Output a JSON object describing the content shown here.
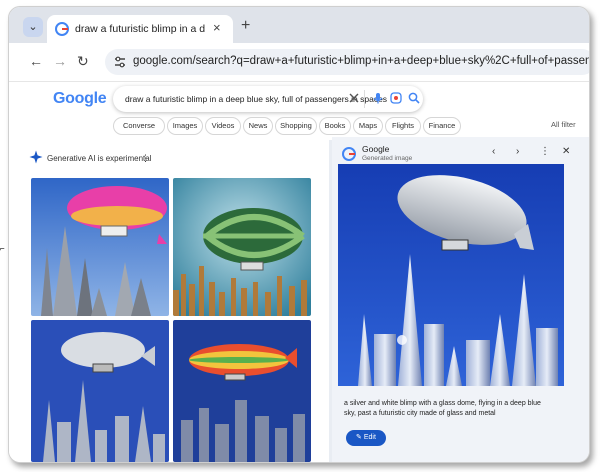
{
  "browser": {
    "tab_title": "draw a futuristic blimp in a de",
    "close_glyph": "×",
    "new_tab_glyph": "+",
    "menu_glyph": "⌄",
    "back_glyph": "←",
    "forward_glyph": "→",
    "reload_glyph": "↻",
    "url": "google.com/search?q=draw+a+futuristic+blimp+in+a+deep+blue+sky%2C+full+of+passengers+in+spaces"
  },
  "search": {
    "logo": "Google",
    "query": "draw a futuristic blimp in a deep blue sky, full of passengers in spaces",
    "chips": [
      "Converse",
      "Images",
      "Videos",
      "News",
      "Shopping",
      "Books",
      "Maps",
      "Flights",
      "Finance"
    ],
    "all_filters": "All filter"
  },
  "generative": {
    "label": "Generative AI is experimental",
    "more_glyph": "⋮"
  },
  "preview": {
    "title": "Google",
    "subtitle": "Generated image",
    "prev_glyph": "‹",
    "next_glyph": "›",
    "more_glyph": "⋮",
    "close_glyph": "✕",
    "caption": "a silver and white blimp with a glass dome, flying in a deep blue sky, past a futuristic city made of glass and metal",
    "edit_label": "Edit"
  },
  "colors": {
    "accent": "#1a57c5",
    "sky_blue": "#1d4fc9",
    "tab_strip": "#dfe3ea"
  }
}
